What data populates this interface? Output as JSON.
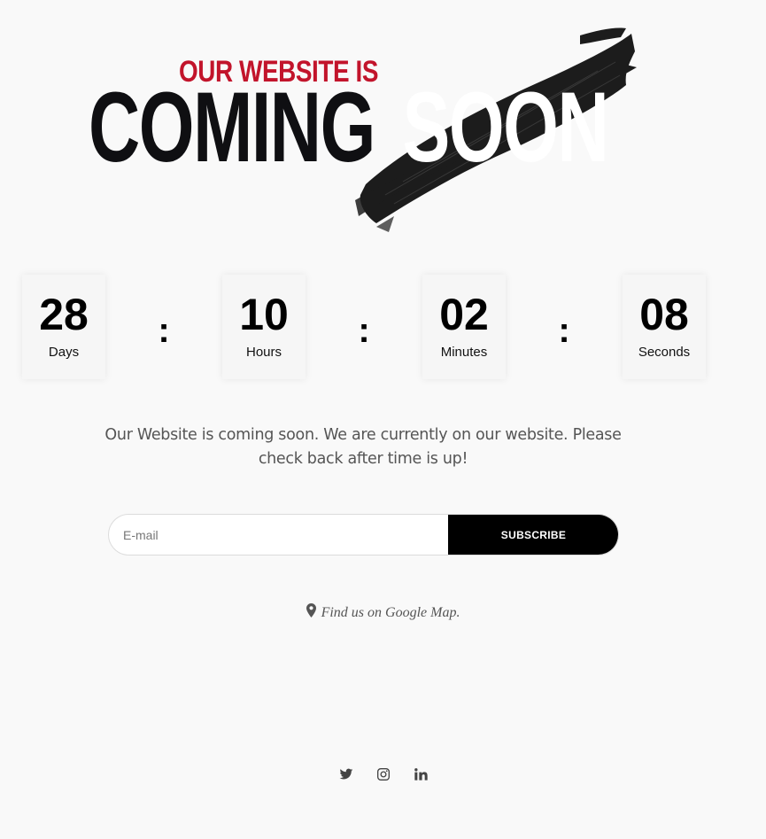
{
  "hero": {
    "top_line": "OUR WEBSITE IS",
    "word1": "COMING",
    "word2": "SOON"
  },
  "colors": {
    "accent_red": "#c2142b",
    "black": "#000000",
    "page_bg": "#f9f9f9",
    "text_gray": "#555555"
  },
  "countdown": {
    "units": [
      {
        "value": "28",
        "label": "Days"
      },
      {
        "value": "10",
        "label": "Hours"
      },
      {
        "value": "02",
        "label": "Minutes"
      },
      {
        "value": "08",
        "label": "Seconds"
      }
    ],
    "separator": ":"
  },
  "message": "Our Website is coming soon. We are currently on our website. Please check back after time is up!",
  "subscribe": {
    "placeholder": "E-mail",
    "button_label": "SUBSCRIBE"
  },
  "map": {
    "icon": "map-marker-icon",
    "link_text": "Find us on Google Map."
  },
  "social": [
    {
      "icon": "twitter-icon"
    },
    {
      "icon": "instagram-icon"
    },
    {
      "icon": "linkedin-icon"
    }
  ]
}
